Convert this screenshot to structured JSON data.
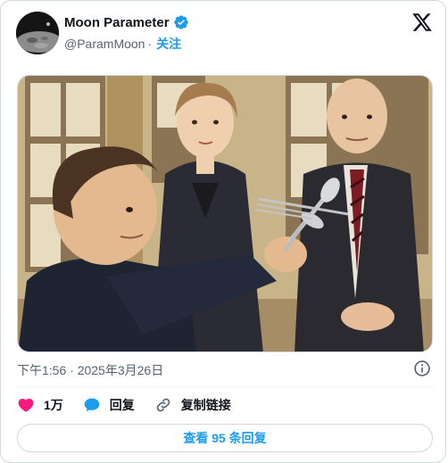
{
  "author": {
    "display_name": "Moon Parameter",
    "handle": "@ParamMoon",
    "separator": "·",
    "follow_label": "关注",
    "verified": true
  },
  "icons": {
    "verified": "verified-badge-icon",
    "brand": "x-logo-icon",
    "info": "info-icon",
    "like": "heart-icon",
    "reply": "speech-bubble-icon",
    "copy_link": "link-icon"
  },
  "media": {
    "alt": "Anime-style illustration of a man holding bent spoons and a fork while a woman and a man in suits watch"
  },
  "post": {
    "timestamp": "下午1:56 · 2025年3月26日"
  },
  "actions": {
    "like_count": "1万",
    "reply_label": "回复",
    "copy_link_label": "复制链接"
  },
  "replies_button": {
    "label": "查看 95 条回复"
  },
  "colors": {
    "accent": "#1d9bf0",
    "like": "#f91880",
    "text_primary": "#0f1419",
    "text_secondary": "#536471",
    "border": "#cfd9de"
  }
}
